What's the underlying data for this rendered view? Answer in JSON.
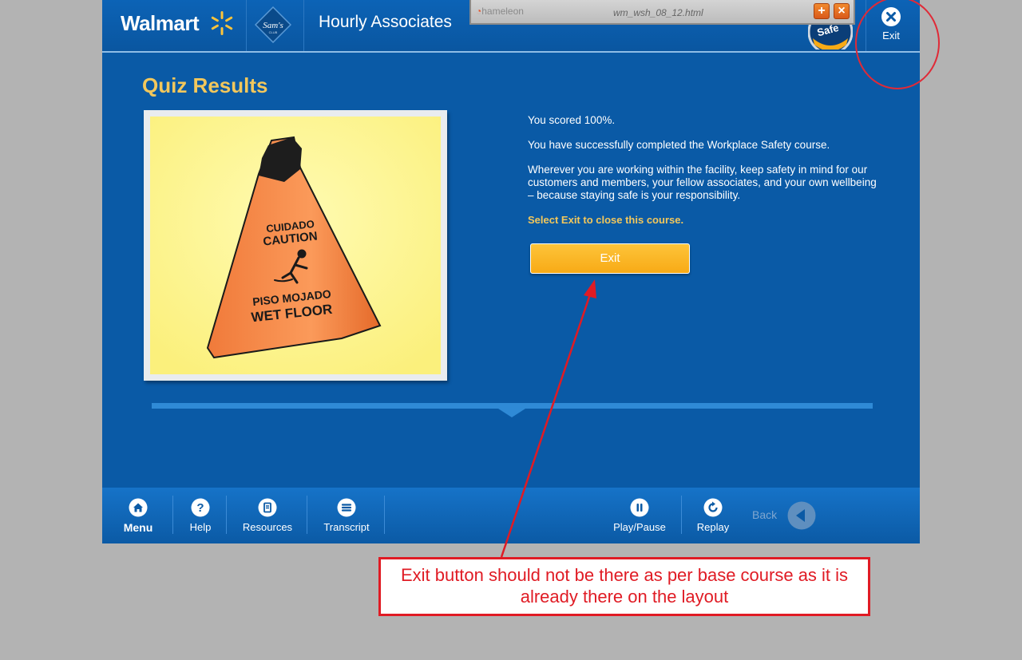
{
  "header": {
    "logo_text": "Walmart",
    "title": "Hourly Associates",
    "exit_label": "Exit",
    "brand_color": "#0a5aa6",
    "accent_color": "#fdc43a"
  },
  "chameleon": {
    "logo_text": "hameleon",
    "filename": "wm_wsh_08_12.html"
  },
  "main": {
    "title": "Quiz Results",
    "photo_text": {
      "line1": "CUIDADO",
      "line2": "CAUTION",
      "line3": "PISO MOJADO",
      "line4": "WET FLOOR"
    },
    "score_text": "You scored 100%.",
    "completed_text": "You have successfully completed the Workplace Safety course.",
    "safety_text": "Wherever you are working within the facility, keep safety in mind for our customers and members, your fellow associates, and your own wellbeing – because staying safe is your responsibility.",
    "instruction_text": "Select Exit to close this course.",
    "exit_button_label": "Exit"
  },
  "footer": {
    "menu_label": "Menu",
    "help_label": "Help",
    "resources_label": "Resources",
    "transcript_label": "Transcript",
    "playpause_label": "Play/Pause",
    "replay_label": "Replay",
    "back_label": "Back"
  },
  "annotation": {
    "note": "Exit button should not be there as per base course as it is already there on the layout",
    "color": "#e01b24"
  }
}
